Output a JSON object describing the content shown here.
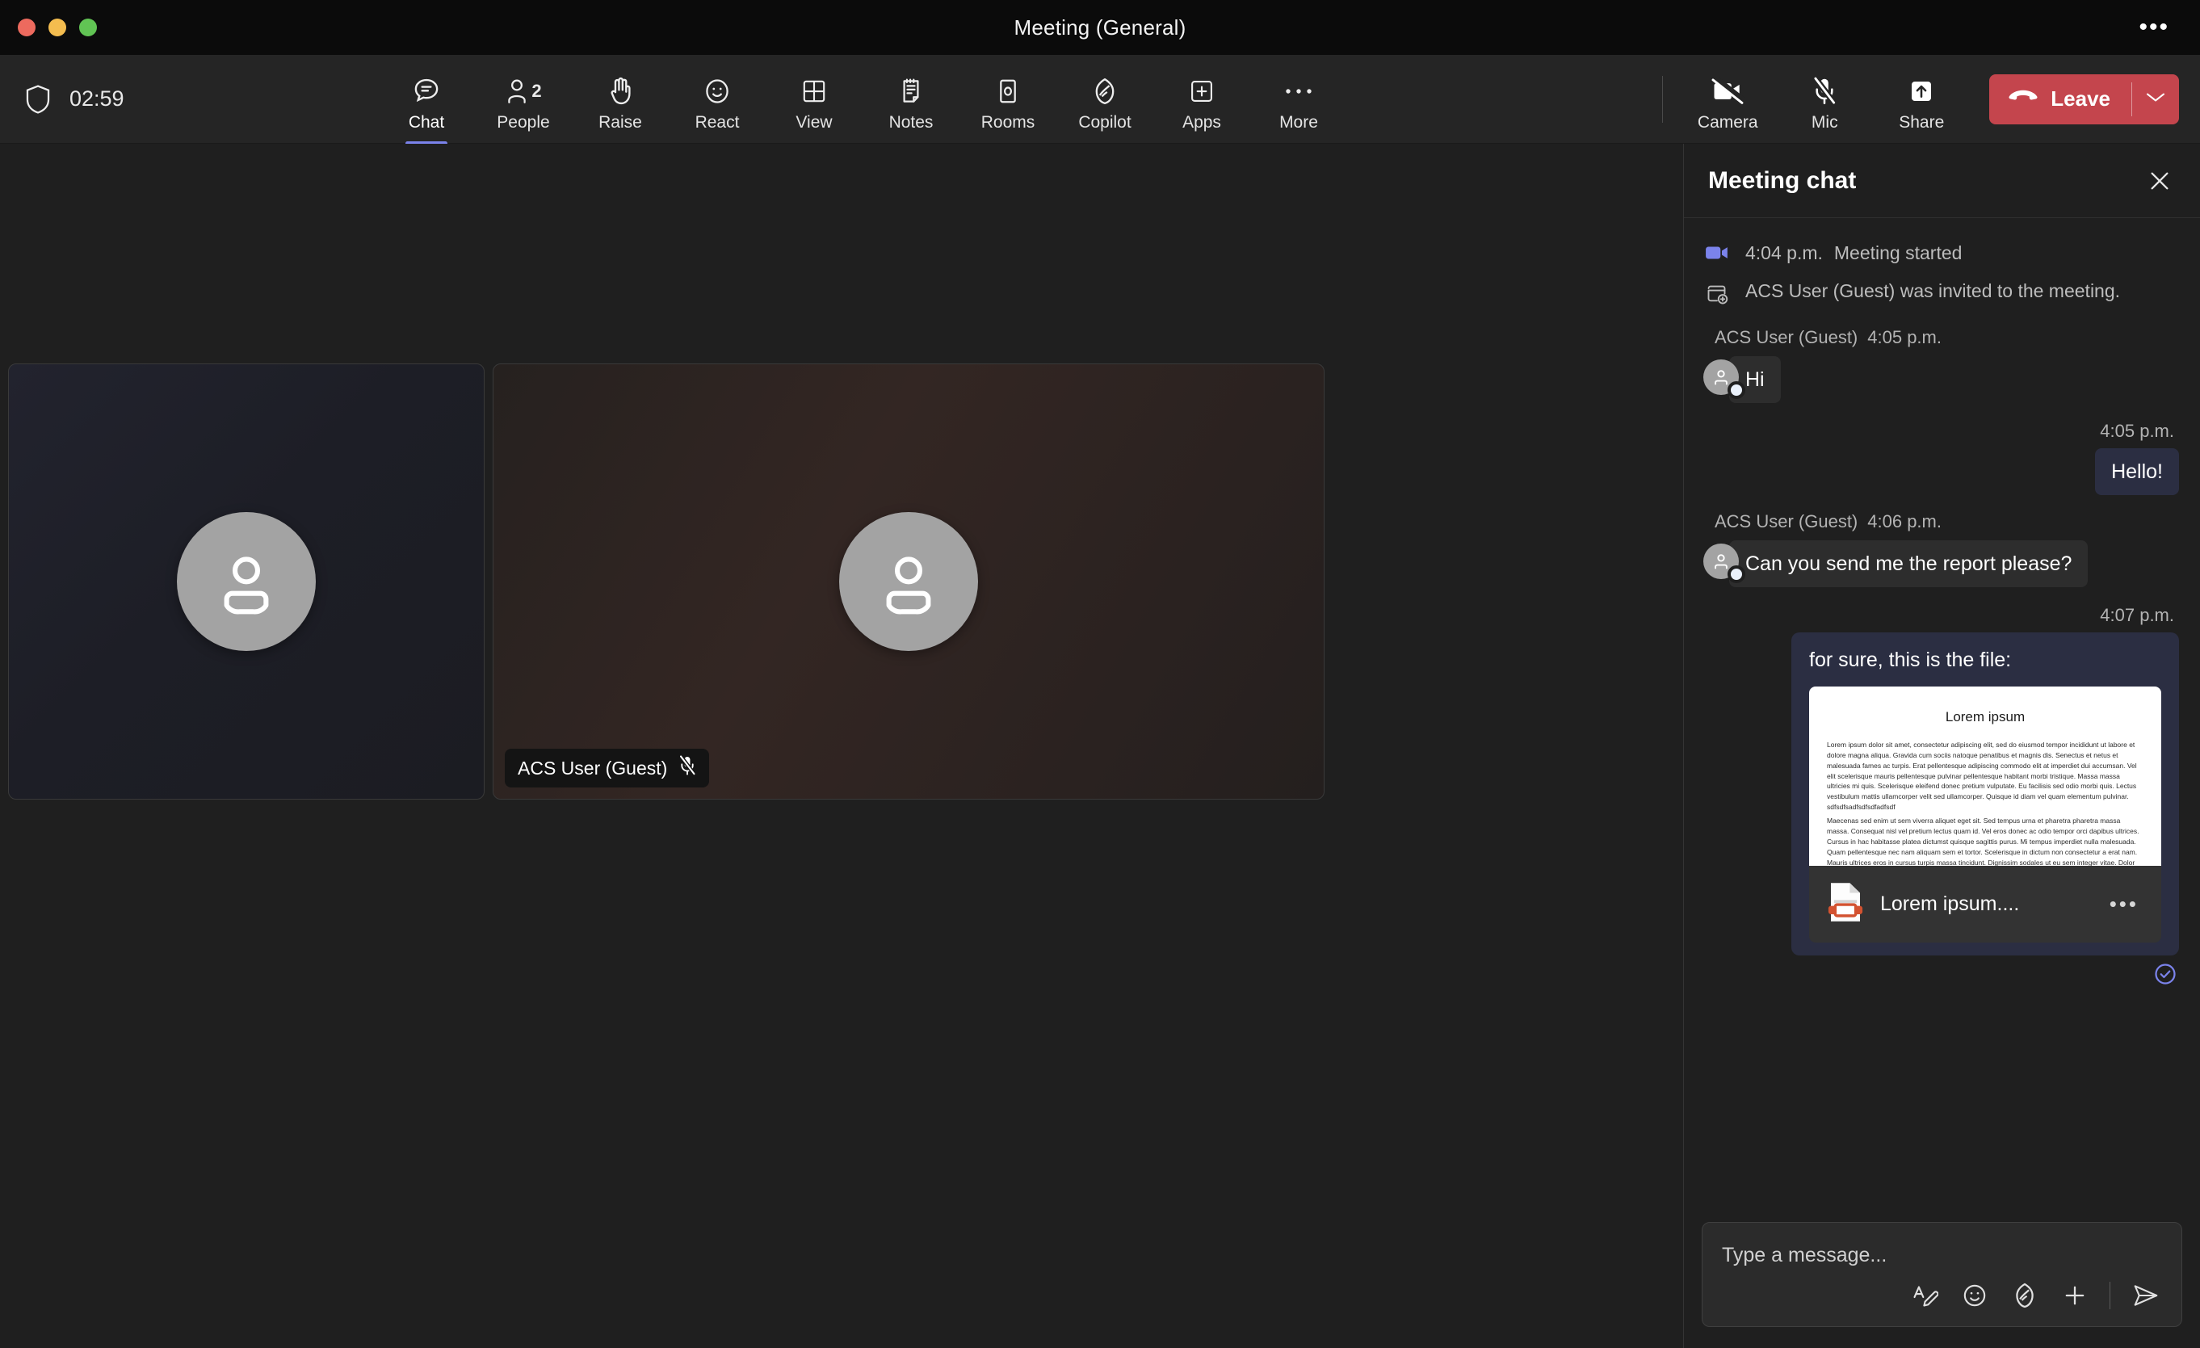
{
  "window": {
    "title": "Meeting (General)",
    "more_label": "•••",
    "traffic_lights": [
      "close",
      "minimize",
      "maximize"
    ]
  },
  "toolbar": {
    "shield_icon": "shield-icon",
    "timer": "02:59",
    "items": [
      {
        "label": "Chat",
        "icon": "chat-icon",
        "active": true,
        "badge": ""
      },
      {
        "label": "People",
        "icon": "people-icon",
        "active": false,
        "badge": "2"
      },
      {
        "label": "Raise",
        "icon": "raise-hand-icon",
        "active": false,
        "badge": ""
      },
      {
        "label": "React",
        "icon": "react-smiley-icon",
        "active": false,
        "badge": ""
      },
      {
        "label": "View",
        "icon": "view-grid-icon",
        "active": false,
        "badge": ""
      },
      {
        "label": "Notes",
        "icon": "notes-icon",
        "active": false,
        "badge": ""
      },
      {
        "label": "Rooms",
        "icon": "rooms-icon",
        "active": false,
        "badge": ""
      },
      {
        "label": "Copilot",
        "icon": "copilot-icon",
        "active": false,
        "badge": ""
      },
      {
        "label": "Apps",
        "icon": "apps-plus-icon",
        "active": false,
        "badge": ""
      },
      {
        "label": "More",
        "icon": "more-ellipsis-icon",
        "active": false,
        "badge": ""
      }
    ],
    "camera": {
      "label": "Camera",
      "icon": "camera-off-icon",
      "muted": true
    },
    "mic": {
      "label": "Mic",
      "icon": "mic-off-icon",
      "muted": true
    },
    "share": {
      "label": "Share",
      "icon": "share-up-arrow-icon"
    },
    "leave": {
      "label": "Leave",
      "icon": "hangup-icon",
      "caret": "chevron-down-icon",
      "color": "#c4454d"
    }
  },
  "stage": {
    "tiles": [
      {
        "name": "",
        "avatar_icon": "person-avatar-icon",
        "muted": false,
        "show_badge": false
      },
      {
        "name": "ACS User (Guest)",
        "avatar_icon": "person-avatar-icon",
        "muted": true,
        "show_badge": true
      }
    ]
  },
  "chat": {
    "title": "Meeting chat",
    "close_icon": "close-icon",
    "system_messages": [
      {
        "icon": "video-started-icon",
        "time": "4:04 p.m.",
        "text": "Meeting started"
      },
      {
        "icon": "calendar-add-icon",
        "time": "",
        "text": "ACS User (Guest) was invited to the meeting."
      }
    ],
    "messages": [
      {
        "direction": "in",
        "sender": "ACS User (Guest)",
        "time": "4:05 p.m.",
        "text": "Hi",
        "avatar_icon": "person-avatar-icon",
        "presence": "available"
      },
      {
        "direction": "out",
        "sender": "",
        "time": "4:05 p.m.",
        "text": "Hello!"
      },
      {
        "direction": "in",
        "sender": "ACS User (Guest)",
        "time": "4:06 p.m.",
        "text": "Can you send me the report please?",
        "avatar_icon": "person-avatar-icon",
        "presence": "available"
      },
      {
        "direction": "out",
        "sender": "",
        "time": "4:07 p.m.",
        "text": "for sure, this is the file:",
        "attachment": {
          "filename": "Lorem ipsum....",
          "file_icon": "powerpoint-file-icon",
          "more_icon": "•••",
          "preview_title": "Lorem ipsum",
          "preview_body_1": "Lorem ipsum dolor sit amet, consectetur adipiscing elit, sed do eiusmod tempor incididunt ut labore et dolore magna aliqua. Gravida cum sociis natoque penatibus et magnis dis. Senectus et netus et malesuada fames ac turpis. Erat pellentesque adipiscing commodo elit at imperdiet dui accumsan. Vel elit scelerisque mauris pellentesque pulvinar pellentesque habitant morbi tristique. Massa massa ultricies mi quis. Scelerisque eleifend donec pretium vulputate. Eu facilisis sed odio morbi quis. Lectus vestibulum mattis ullamcorper velit sed ullamcorper. Quisque id diam vel quam elementum pulvinar. sdfsdfsadfsdfsdfadfsdf",
          "preview_body_2": "Maecenas sed enim ut sem viverra aliquet eget sit. Sed tempus urna et pharetra pharetra massa massa. Consequat nisl vel pretium lectus quam id. Vel eros donec ac odio tempor orci dapibus ultrices. Cursus in hac habitasse platea dictumst quisque sagittis purus. Mi tempus imperdiet nulla malesuada. Quam pellentesque nec nam aliquam sem et tortor. Scelerisque in dictum non consectetur a erat nam. Mauris ultrices eros in cursus turpis massa tincidunt. Dignissim sodales ut eu sem integer vitae. Dolor sit amet consectetur"
        },
        "status_icon": "delivered-check-icon",
        "status_color": "#7b83eb"
      }
    ],
    "compose": {
      "placeholder": "Type a message...",
      "actions": [
        {
          "icon": "format-text-icon",
          "name": "format-button"
        },
        {
          "icon": "emoji-icon",
          "name": "emoji-button"
        },
        {
          "icon": "copilot-icon",
          "name": "copilot-button"
        },
        {
          "icon": "plus-icon",
          "name": "add-attachment-button"
        },
        {
          "icon": "send-icon",
          "name": "send-button"
        }
      ]
    }
  }
}
